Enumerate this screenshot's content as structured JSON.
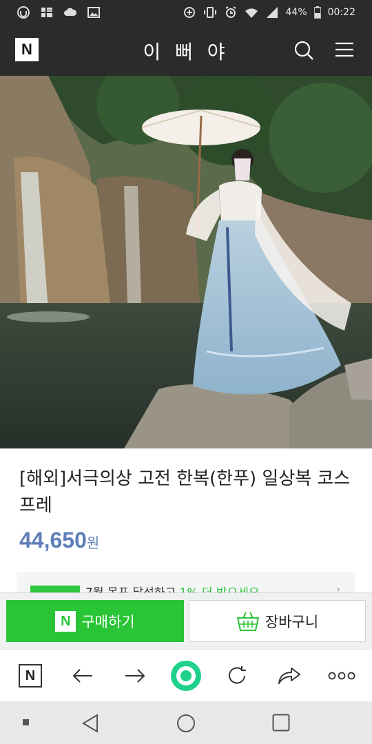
{
  "status_bar": {
    "battery": "44%",
    "time": "00:22"
  },
  "header": {
    "logo": "N",
    "title": "이 뻐 야"
  },
  "product": {
    "title": "[해외]서극의상 고전 한복(한푸) 일상복 코스프레",
    "price": "44,650",
    "currency": "원"
  },
  "promo": {
    "text_before": "7월 목표 달성하고 ",
    "highlight": "1% 더 받으세요",
    "arrow": "›"
  },
  "actions": {
    "buy_n": "N",
    "buy_label": "구매하기",
    "cart_label": "장바구니"
  },
  "browser_nav": {
    "home_logo": "N",
    "more": "ooo"
  },
  "colors": {
    "brand_green": "#2ac536",
    "price_blue": "#5f7fb8",
    "header_bg": "#2b2b2b"
  }
}
